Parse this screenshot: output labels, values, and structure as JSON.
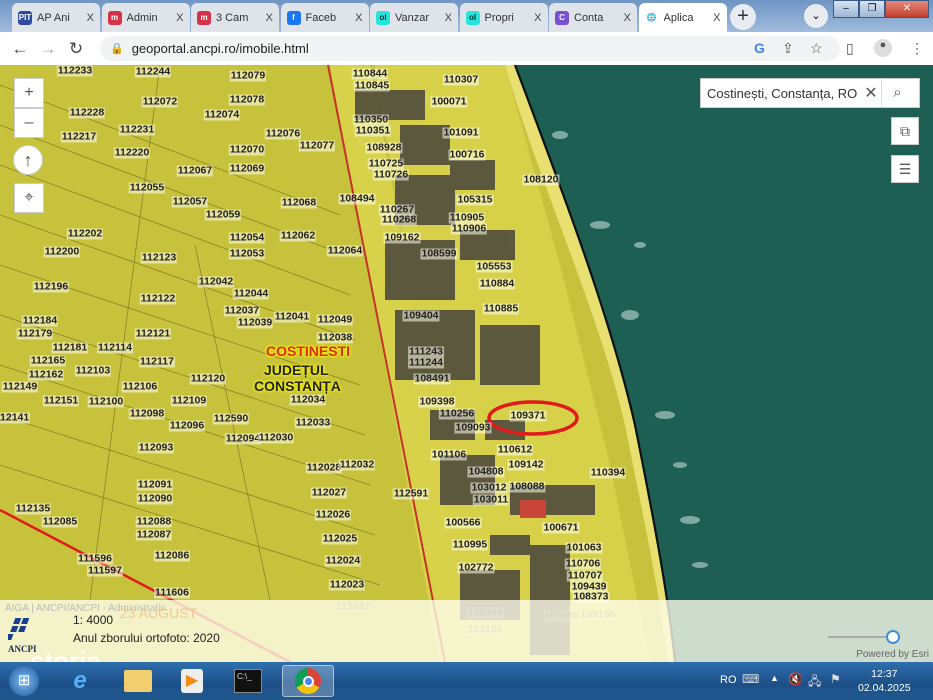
{
  "browser": {
    "tabs": [
      {
        "label": "AP Ani",
        "icon": "PIT",
        "color": "#2d4a9c"
      },
      {
        "label": "Admin",
        "icon": "m",
        "color": "#d6334a"
      },
      {
        "label": "3 Cam",
        "icon": "m",
        "color": "#d6334a"
      },
      {
        "label": "Faceb",
        "icon": "f",
        "color": "#1877f2"
      },
      {
        "label": "Vanzar",
        "icon": "olx",
        "color": "#23e5db"
      },
      {
        "label": "Propri",
        "icon": "olx",
        "color": "#23e5db"
      },
      {
        "label": "Conta",
        "icon": "C",
        "color": "#7b4fd1"
      },
      {
        "label": "Aplica",
        "icon": "globe",
        "color": "#555555",
        "active": true
      }
    ],
    "close_glyph": "X",
    "url": "geoportal.ancpi.ro/imobile.html"
  },
  "map": {
    "search_value": "Costinești, Constanța, RO",
    "zoom_in": "+",
    "zoom_out": "–",
    "place_name": "COSTINESTI",
    "county_line1": "JUDEȚUL",
    "county_line2": "CONSTANȚA",
    "highlighted_parcel": "109371",
    "highlight_color": "#e01b1b",
    "parcels": [
      "112233",
      "112244",
      "112079",
      "112228",
      "112072",
      "112078",
      "112074",
      "112217",
      "112231",
      "112076",
      "112220",
      "112070",
      "112077",
      "112067",
      "112069",
      "112055",
      "112057",
      "112068",
      "112059",
      "112202",
      "112054",
      "112062",
      "112200",
      "112123",
      "112053",
      "112064",
      "112196",
      "112042",
      "112122",
      "112044",
      "112184",
      "112037",
      "112041",
      "112049",
      "112039",
      "112179",
      "112121",
      "112038",
      "112181",
      "112114",
      "112165",
      "112117",
      "112162",
      "112103",
      "112120",
      "112149",
      "112106",
      "112151",
      "112100",
      "112109",
      "112034",
      "112098",
      "112590",
      "112033",
      "112141",
      "112096",
      "112094",
      "112030",
      "112093",
      "112028",
      "112032",
      "112091",
      "112027",
      "112090",
      "112135",
      "112085",
      "112088",
      "112026",
      "112087",
      "112025",
      "111596",
      "112086",
      "111597",
      "112024",
      "111606",
      "112023",
      "112022",
      "110844",
      "110845",
      "110307",
      "100071",
      "110350",
      "110351",
      "101091",
      "108928",
      "100716",
      "110725",
      "110726",
      "108120",
      "108494",
      "105315",
      "110267",
      "110905",
      "110268",
      "110906",
      "109162",
      "108599",
      "105553",
      "110884",
      "110885",
      "109404",
      "111243",
      "111244",
      "108491",
      "109398",
      "110256",
      "109093",
      "110612",
      "101106",
      "109142",
      "110394",
      "104808",
      "103012",
      "108088",
      "103011",
      "112591",
      "100566",
      "100671",
      "110995",
      "101063",
      "110706",
      "102772",
      "110707",
      "109439",
      "108373",
      "100364",
      "109195",
      "106905",
      "103155"
    ]
  },
  "bottom": {
    "faint_text": "AIGA | ANCPI/ANCPI - Administrativ",
    "faint_place": "23 AUGUST",
    "scale": "1: 4000",
    "ortho_year": "Anul zborului ortofoto: 2020",
    "powered": "Powered by Esri",
    "logo_text": "ANCPI",
    "watermark": "storia",
    "slider_value": 0.9
  },
  "taskbar": {
    "lang": "RO",
    "time": "12:37",
    "date": "02.04.2025"
  }
}
